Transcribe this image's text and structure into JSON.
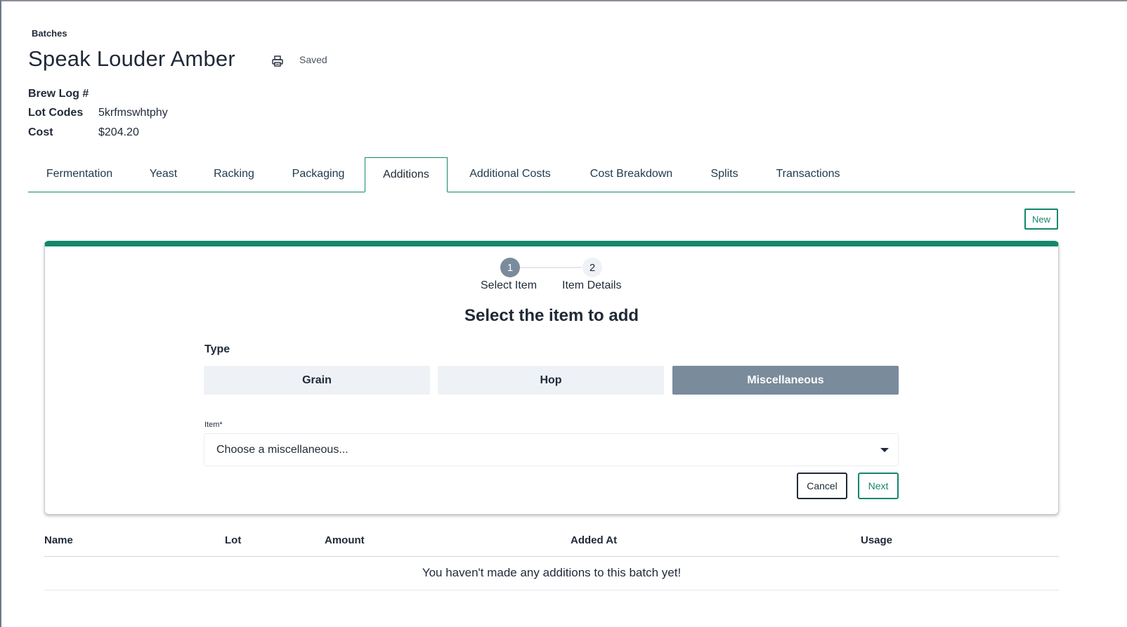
{
  "breadcrumb": "Batches",
  "title": "Speak Louder Amber",
  "status": "Saved",
  "icons": {
    "print": "printer-icon",
    "dropdown": "caret-down-icon"
  },
  "colors": {
    "accent": "#14866d",
    "selected_type": "#7a8b9c",
    "text": "#1f2937"
  },
  "meta": {
    "brew_log_label": "Brew Log #",
    "brew_log_value": "",
    "lot_codes_label": "Lot Codes",
    "lot_codes_value": "5krfmswhtphy",
    "cost_label": "Cost",
    "cost_value": "$204.20"
  },
  "tabs": [
    {
      "label": "Fermentation",
      "active": false
    },
    {
      "label": "Yeast",
      "active": false
    },
    {
      "label": "Racking",
      "active": false
    },
    {
      "label": "Packaging",
      "active": false
    },
    {
      "label": "Additions",
      "active": true
    },
    {
      "label": "Additional Costs",
      "active": false
    },
    {
      "label": "Cost Breakdown",
      "active": false
    },
    {
      "label": "Splits",
      "active": false
    },
    {
      "label": "Transactions",
      "active": false
    }
  ],
  "new_button": "New",
  "wizard": {
    "steps": [
      {
        "number": "1",
        "label": "Select Item",
        "current": true
      },
      {
        "number": "2",
        "label": "Item Details",
        "current": false
      }
    ],
    "heading": "Select the item to add",
    "type_label": "Type",
    "types": [
      {
        "label": "Grain",
        "selected": false
      },
      {
        "label": "Hop",
        "selected": false
      },
      {
        "label": "Miscellaneous",
        "selected": true
      }
    ],
    "item_label": "Item*",
    "item_placeholder": "Choose a miscellaneous...",
    "cancel": "Cancel",
    "next": "Next"
  },
  "table": {
    "columns": [
      "Name",
      "Lot",
      "Amount",
      "Added At",
      "Usage"
    ],
    "empty_message": "You haven't made any additions to this batch yet!"
  }
}
